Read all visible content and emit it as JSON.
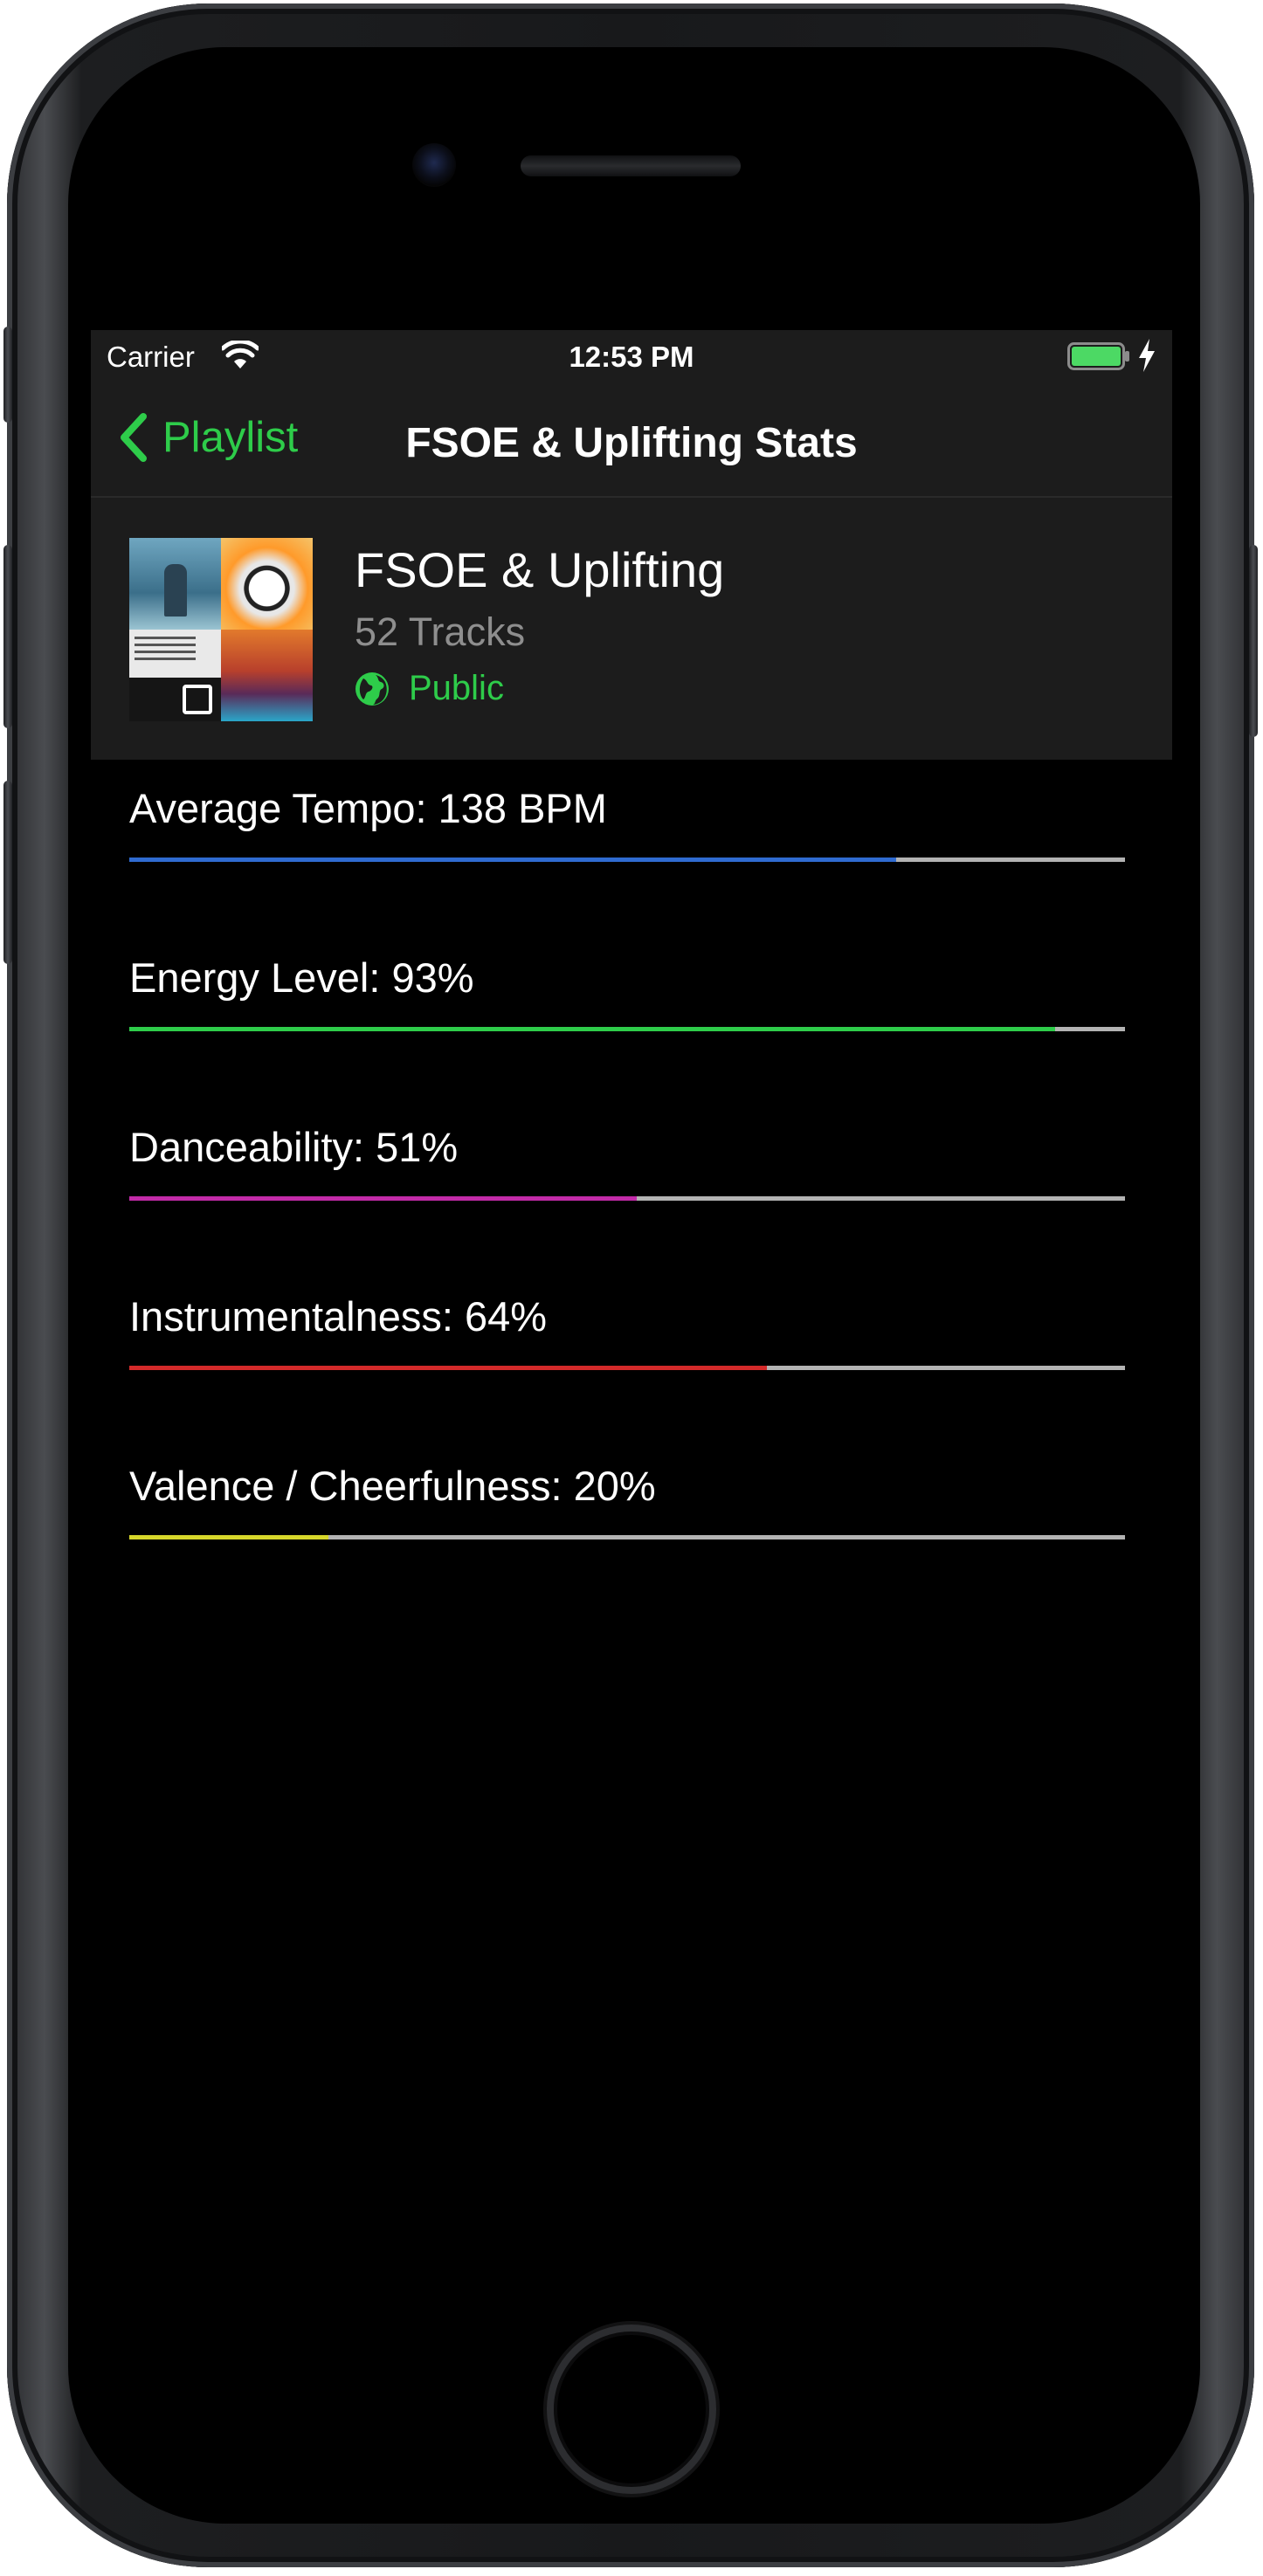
{
  "status_bar": {
    "carrier": "Carrier",
    "time": "12:53 PM",
    "icons": [
      "wifi-icon",
      "battery-icon",
      "charging-bolt-icon"
    ],
    "battery_color": "#4cd964"
  },
  "nav": {
    "back_label": "Playlist",
    "back_icon": "chevron-left-icon",
    "title": "FSOE & Uplifting Stats"
  },
  "playlist": {
    "name": "FSOE & Uplifting",
    "track_count": "52 Tracks",
    "visibility": "Public",
    "visibility_icon": "globe-icon"
  },
  "colors": {
    "accent": "#2ecc4a",
    "background": "#000000",
    "header_background": "#1c1c1c",
    "track": "#b3b3b3"
  },
  "stats": [
    {
      "label": "Average Tempo: 138 BPM",
      "fill": 0.77,
      "color": "#2f6bd0"
    },
    {
      "label": "Energy Level: 93%",
      "fill": 0.93,
      "color": "#2ecc4a"
    },
    {
      "label": "Danceability: 51%",
      "fill": 0.51,
      "color": "#c22aa8"
    },
    {
      "label": "Instrumentalness: 64%",
      "fill": 0.64,
      "color": "#d42a2a"
    },
    {
      "label": "Valence / Cheerfulness: 20%",
      "fill": 0.2,
      "color": "#d6d62a"
    }
  ]
}
